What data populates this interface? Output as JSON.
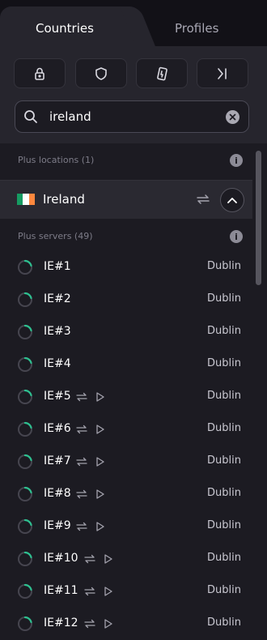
{
  "tabs": {
    "countries": "Countries",
    "profiles": "Profiles"
  },
  "filters": [
    {
      "icon": "lock-icon"
    },
    {
      "icon": "shield-icon"
    },
    {
      "icon": "mobile-icon"
    },
    {
      "icon": "arrow-right-bar-icon"
    }
  ],
  "search": {
    "value": "ireland",
    "placeholder": ""
  },
  "plus_locations": {
    "label": "Plus locations (1)"
  },
  "country": {
    "name": "Ireland",
    "flag_colors": [
      "#169b62",
      "#ffffff",
      "#ff883e"
    ]
  },
  "plus_servers": {
    "label": "Plus servers (49)"
  },
  "servers": [
    {
      "name": "IE#1",
      "city": "Dublin",
      "actions": false
    },
    {
      "name": "IE#2",
      "city": "Dublin",
      "actions": false
    },
    {
      "name": "IE#3",
      "city": "Dublin",
      "actions": false
    },
    {
      "name": "IE#4",
      "city": "Dublin",
      "actions": false
    },
    {
      "name": "IE#5",
      "city": "Dublin",
      "actions": true
    },
    {
      "name": "IE#6",
      "city": "Dublin",
      "actions": true
    },
    {
      "name": "IE#7",
      "city": "Dublin",
      "actions": true
    },
    {
      "name": "IE#8",
      "city": "Dublin",
      "actions": true
    },
    {
      "name": "IE#9",
      "city": "Dublin",
      "actions": true
    },
    {
      "name": "IE#10",
      "city": "Dublin",
      "actions": true
    },
    {
      "name": "IE#11",
      "city": "Dublin",
      "actions": true
    },
    {
      "name": "IE#12",
      "city": "Dublin",
      "actions": true
    }
  ],
  "colors": {
    "load_ring": "#2dbf8f",
    "background": "#1c1b22"
  }
}
